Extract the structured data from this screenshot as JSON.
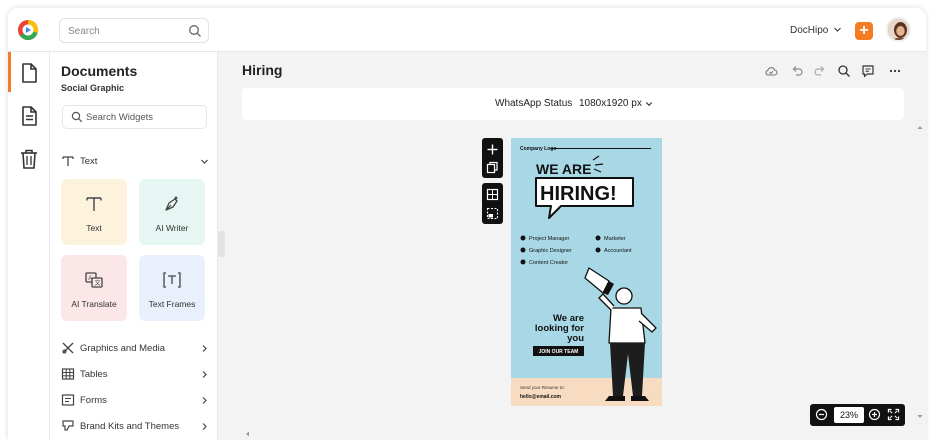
{
  "header": {
    "search_placeholder": "Search",
    "account_name": "DocHipo",
    "add_label": "+"
  },
  "rail": {
    "items": [
      "documents-icon",
      "page-icon",
      "trash-icon"
    ]
  },
  "panel": {
    "title": "Documents",
    "subtitle": "Social Graphic",
    "search_placeholder": "Search Widgets",
    "text_section": "Text",
    "cards": [
      "Text",
      "AI Writer",
      "AI Translate",
      "Text Frames"
    ],
    "sections": [
      "Graphics and Media",
      "Tables",
      "Forms",
      "Brand Kits and Themes"
    ]
  },
  "main": {
    "doc_title": "Hiring",
    "format_label": "WhatsApp Status",
    "dimensions": "1080x1920 px",
    "zoom": "23%"
  },
  "poster": {
    "company_logo": "Company Logo",
    "headline_1": "WE ARE",
    "headline_2": "HIRING!",
    "roles": [
      "Project Manager",
      "Marketer",
      "Graphic Designer",
      "Accountant",
      "Content Creator"
    ],
    "looking_1": "We are",
    "looking_2": "looking for",
    "looking_3": "you",
    "cta": "JOIN OUR TEAM",
    "resume_label": "Send your Resume to:",
    "email": "hello@email.com"
  },
  "colors": {
    "accent": "#f57c22",
    "poster_bg": "#a8d8e6",
    "poster_footer": "#f7dcc2"
  }
}
